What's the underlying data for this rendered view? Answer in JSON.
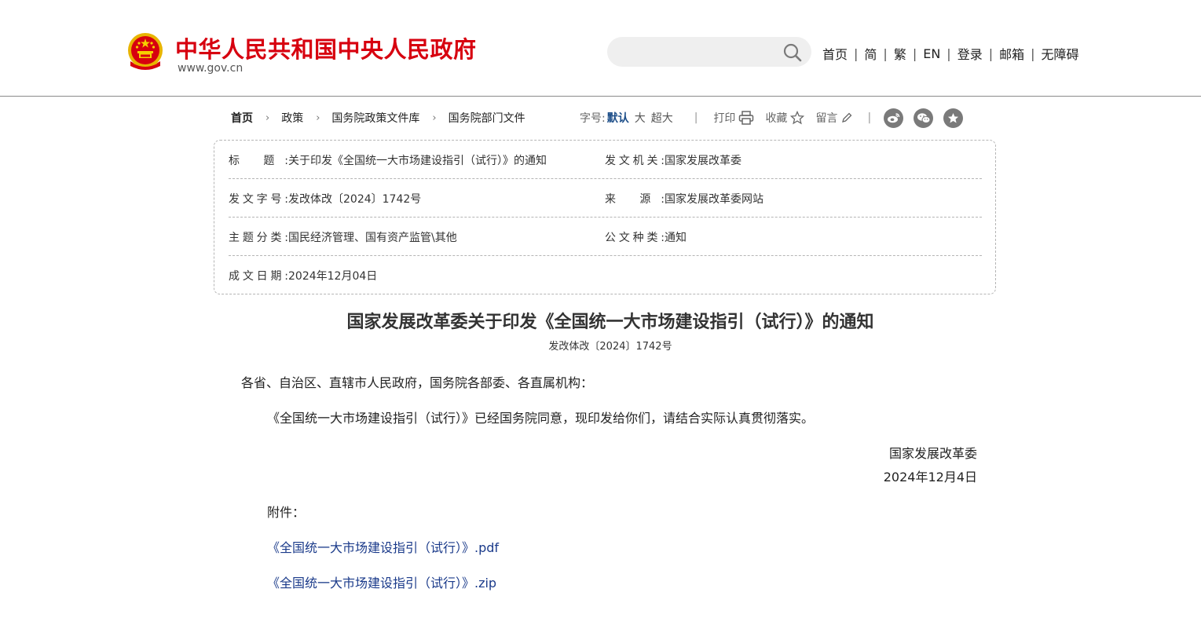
{
  "header": {
    "site_title": "中华人民共和国中央人民政府",
    "site_domain": "www.gov.cn",
    "search": {
      "placeholder": "",
      "value": ""
    },
    "nav": [
      "首页",
      "简",
      "繁",
      "EN",
      "登录",
      "邮箱",
      "无障碍"
    ],
    "separator": "|"
  },
  "breadcrumb": {
    "items": [
      "首页",
      "政策",
      "国务院政策文件库",
      "国务院部门文件"
    ],
    "chevron": "›"
  },
  "toolbar": {
    "font_size_label": "字号:",
    "font_sizes": [
      "默认",
      "大",
      "超大"
    ],
    "print_label": "打印",
    "favorite_label": "收藏",
    "comment_label": "留言",
    "divider": "|"
  },
  "meta": {
    "rows": [
      {
        "left_key": "标 题:",
        "left_value": "关于印发《全国统一大市场建设指引（试行）》的通知",
        "right_key": "发文机关:",
        "right_value": "国家发展改革委"
      },
      {
        "left_key": "发文字号:",
        "left_value": "发改体改〔2024〕1742号",
        "right_key": "来 源:",
        "right_value": "国家发展改革委网站"
      },
      {
        "left_key": "主题分类:",
        "left_value": "国民经济管理、国有资产监管\\其他",
        "right_key": "公文种类:",
        "right_value": "通知"
      },
      {
        "left_key": "成文日期:",
        "left_value": "2024年12月04日"
      }
    ]
  },
  "article": {
    "title": "国家发展改革委关于印发《全国统一大市场建设指引（试行）》的通知",
    "doc_no": "发改体改〔2024〕1742号",
    "salutation": "各省、自治区、直辖市人民政府，国务院各部委、各直属机构：",
    "body": "《全国统一大市场建设指引（试行）》已经国务院同意，现印发给你们，请结合实际认真贯彻落实。",
    "signature_org": "国家发展改革委",
    "signature_date": "2024年12月4日",
    "attachments_label": "附件：",
    "attachments": [
      "《全国统一大市场建设指引（试行）》.pdf",
      "《全国统一大市场建设指引（试行）》.zip"
    ]
  },
  "colors": {
    "brand_red": "#d7000f",
    "link_blue": "#1a3a8a",
    "active_font": "#1d4e89",
    "share_gray": "#7a7a7a"
  },
  "icons": [
    "national-emblem",
    "search-icon",
    "print-icon",
    "star-icon",
    "pencil-icon",
    "weibo-icon",
    "wechat-icon",
    "favorite-circle-icon"
  ]
}
